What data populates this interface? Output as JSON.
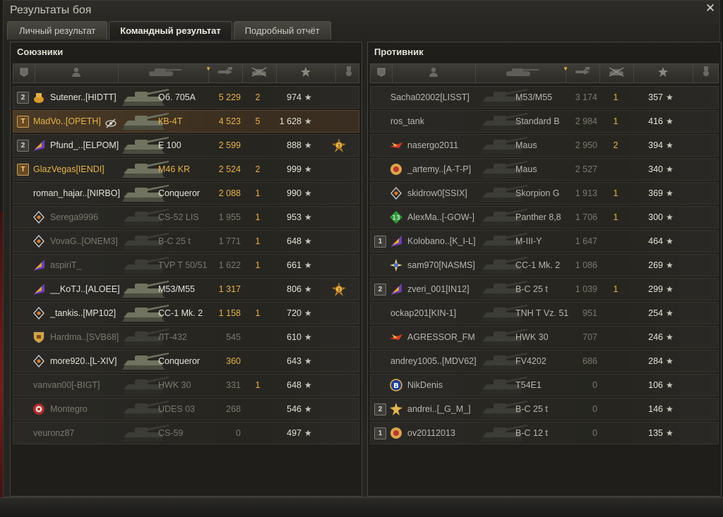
{
  "window": {
    "title": "Результаты боя"
  },
  "tabs": [
    {
      "label": "Личный результат"
    },
    {
      "label": "Командный результат"
    },
    {
      "label": "Подробный отчёт"
    }
  ],
  "colors": {
    "gold": "#e8b347",
    "highlight_row": "#4a3a26"
  },
  "header_icons": [
    "squad-icon",
    "player-icon",
    "vehicle-icon",
    "damage-icon",
    "kills-icon",
    "xp-star-icon",
    "medal-icon"
  ],
  "allies": {
    "title": "Союзники",
    "rows": [
      {
        "squad": "2",
        "clan_icon": "gold-pot",
        "player": "Sutener..[HIDTT]",
        "vehicle": "Об. 705А",
        "damage": "5 229",
        "kills": "2",
        "xp": "974",
        "medal": "",
        "tone": "white",
        "hl": false,
        "vtone": "white",
        "dtone": "gold"
      },
      {
        "squad": "T",
        "clan_icon": "",
        "player": "MadVo..[OPETH]",
        "vehicle": "КВ-4Т",
        "damage": "4 523",
        "kills": "5",
        "xp": "1 628",
        "medal": "",
        "tone": "gold",
        "hl": true,
        "vtone": "gold",
        "dtone": "gold",
        "eye": true
      },
      {
        "squad": "2",
        "clan_icon": "purple-flag",
        "player": "Pfund_..[ELPOM]",
        "vehicle": "E 100",
        "damage": "2 599",
        "kills": "",
        "xp": "888",
        "medal": "medal",
        "tone": "white",
        "hl": false,
        "vtone": "white",
        "dtone": "gold"
      },
      {
        "squad": "T",
        "clan_icon": "",
        "player": "GlazVegas[IENDI]",
        "vehicle": "M46 KR",
        "damage": "2 524",
        "kills": "2",
        "xp": "999",
        "medal": "",
        "tone": "gold",
        "hl": false,
        "vtone": "gold",
        "dtone": "gold"
      },
      {
        "squad": "",
        "clan_icon": "",
        "player": "roman_hajar..[NIRBO]",
        "vehicle": "Conqueror",
        "damage": "2 088",
        "kills": "1",
        "xp": "990",
        "medal": "",
        "tone": "white",
        "hl": false,
        "vtone": "white",
        "dtone": "gold"
      },
      {
        "squad": "",
        "clan_icon": "diamond",
        "player": "Serega9996",
        "vehicle": "CS-52 LIS",
        "damage": "1 955",
        "kills": "1",
        "xp": "953",
        "medal": "",
        "tone": "dim",
        "hl": false,
        "vtone": "dim",
        "dtone": "dim"
      },
      {
        "squad": "",
        "clan_icon": "diamond",
        "player": "VovaG..[ONEM3]",
        "vehicle": "В-С 25 t",
        "damage": "1 771",
        "kills": "1",
        "xp": "648",
        "medal": "",
        "tone": "dim",
        "hl": false,
        "vtone": "dim",
        "dtone": "dim"
      },
      {
        "squad": "",
        "clan_icon": "purple-flag",
        "player": "aspiriT_",
        "vehicle": "TVP T 50/51",
        "damage": "1 622",
        "kills": "1",
        "xp": "661",
        "medal": "",
        "tone": "dim",
        "hl": false,
        "vtone": "dim",
        "dtone": "dim"
      },
      {
        "squad": "",
        "clan_icon": "purple-flag",
        "player": "__KoTJ..[ALOEE]",
        "vehicle": "M53/M55",
        "damage": "1 317",
        "kills": "",
        "xp": "806",
        "medal": "medal",
        "tone": "white",
        "hl": false,
        "vtone": "white",
        "dtone": "gold"
      },
      {
        "squad": "",
        "clan_icon": "diamond",
        "player": "_tankis..[MP102]",
        "vehicle": "СС-1 Мk. 2",
        "damage": "1 158",
        "kills": "1",
        "xp": "720",
        "medal": "",
        "tone": "white",
        "hl": false,
        "vtone": "white",
        "dtone": "gold"
      },
      {
        "squad": "",
        "clan_icon": "shield",
        "player": "Hardma..[SVB68]",
        "vehicle": "ЛТ-432",
        "damage": "545",
        "kills": "",
        "xp": "610",
        "medal": "",
        "tone": "dim",
        "hl": false,
        "vtone": "dim",
        "dtone": "dim"
      },
      {
        "squad": "",
        "clan_icon": "diamond",
        "player": "more920..[L-XIV]",
        "vehicle": "Conqueror",
        "damage": "360",
        "kills": "",
        "xp": "643",
        "medal": "",
        "tone": "white",
        "hl": false,
        "vtone": "white",
        "dtone": "gold"
      },
      {
        "squad": "",
        "clan_icon": "",
        "player": "vanvan00[-BIGT]",
        "vehicle": "HWK 30",
        "damage": "331",
        "kills": "1",
        "xp": "648",
        "medal": "",
        "tone": "dim",
        "hl": false,
        "vtone": "dim",
        "dtone": "dim"
      },
      {
        "squad": "",
        "clan_icon": "red-target",
        "player": "Montegro",
        "vehicle": "UDES 03",
        "damage": "268",
        "kills": "",
        "xp": "546",
        "medal": "",
        "tone": "dim",
        "hl": false,
        "vtone": "dim",
        "dtone": "dim"
      },
      {
        "squad": "",
        "clan_icon": "",
        "player": "veuronz87",
        "vehicle": "CS-59",
        "damage": "0",
        "kills": "",
        "xp": "497",
        "medal": "",
        "tone": "dim",
        "hl": false,
        "vtone": "dim",
        "dtone": "dim"
      }
    ]
  },
  "enemies": {
    "title": "Противник",
    "rows": [
      {
        "squad": "",
        "clan_icon": "",
        "player": "Sacha02002[LISST]",
        "vehicle": "M53/M55",
        "damage": "3 174",
        "kills": "1",
        "xp": "357",
        "medal": ""
      },
      {
        "squad": "",
        "clan_icon": "",
        "player": "ros_tank",
        "vehicle": "Standard B",
        "damage": "2 984",
        "kills": "1",
        "xp": "416",
        "medal": ""
      },
      {
        "squad": "",
        "clan_icon": "red-plane",
        "player": "nasergo2011",
        "vehicle": "Maus",
        "damage": "2 950",
        "kills": "2",
        "xp": "394",
        "medal": ""
      },
      {
        "squad": "",
        "clan_icon": "gold-emblem",
        "player": "_artemy..[A-T-P]",
        "vehicle": "Maus",
        "damage": "2 527",
        "kills": "",
        "xp": "340",
        "medal": ""
      },
      {
        "squad": "",
        "clan_icon": "diamond",
        "player": "skidrow0[SSIX]",
        "vehicle": "Skorpion G",
        "damage": "1 913",
        "kills": "1",
        "xp": "369",
        "medal": ""
      },
      {
        "squad": "",
        "clan_icon": "green-13",
        "player": "AlexMa..[-GOW-]",
        "vehicle": "Panther 8,8",
        "damage": "1 706",
        "kills": "1",
        "xp": "300",
        "medal": ""
      },
      {
        "squad": "1",
        "clan_icon": "purple-flag",
        "player": "Kolobano..[K_I-L]",
        "vehicle": "M-III-Y",
        "damage": "1 647",
        "kills": "",
        "xp": "464",
        "medal": ""
      },
      {
        "squad": "",
        "clan_icon": "star-flower",
        "player": "sam970[NASMS]",
        "vehicle": "CC-1 Mk. 2",
        "damage": "1 086",
        "kills": "",
        "xp": "269",
        "medal": ""
      },
      {
        "squad": "2",
        "clan_icon": "purple-flag",
        "player": "zveri_001[IN12]",
        "vehicle": "В-С 25 t",
        "damage": "1 039",
        "kills": "1",
        "xp": "299",
        "medal": ""
      },
      {
        "squad": "",
        "clan_icon": "",
        "player": "ockap201[KIN-1]",
        "vehicle": "TNH T Vz. 51",
        "damage": "951",
        "kills": "",
        "xp": "254",
        "medal": ""
      },
      {
        "squad": "",
        "clan_icon": "red-plane",
        "player": "AGRESSOR_FM",
        "vehicle": "HWK 30",
        "damage": "707",
        "kills": "",
        "xp": "246",
        "medal": ""
      },
      {
        "squad": "",
        "clan_icon": "",
        "player": "andrey1005..[MDV62]",
        "vehicle": "FV4202",
        "damage": "686",
        "kills": "",
        "xp": "284",
        "medal": ""
      },
      {
        "squad": "",
        "clan_icon": "b-badge",
        "player": "NikDenis",
        "vehicle": "T54E1",
        "damage": "0",
        "kills": "",
        "xp": "106",
        "medal": ""
      },
      {
        "squad": "2",
        "clan_icon": "gold-star",
        "player": "andrei..[_G_M_]",
        "vehicle": "В-С 25 t",
        "damage": "0",
        "kills": "",
        "xp": "146",
        "medal": ""
      },
      {
        "squad": "1",
        "clan_icon": "gold-emblem",
        "player": "ov20112013",
        "vehicle": "В-С 12 t",
        "damage": "0",
        "kills": "",
        "xp": "135",
        "medal": ""
      }
    ]
  }
}
